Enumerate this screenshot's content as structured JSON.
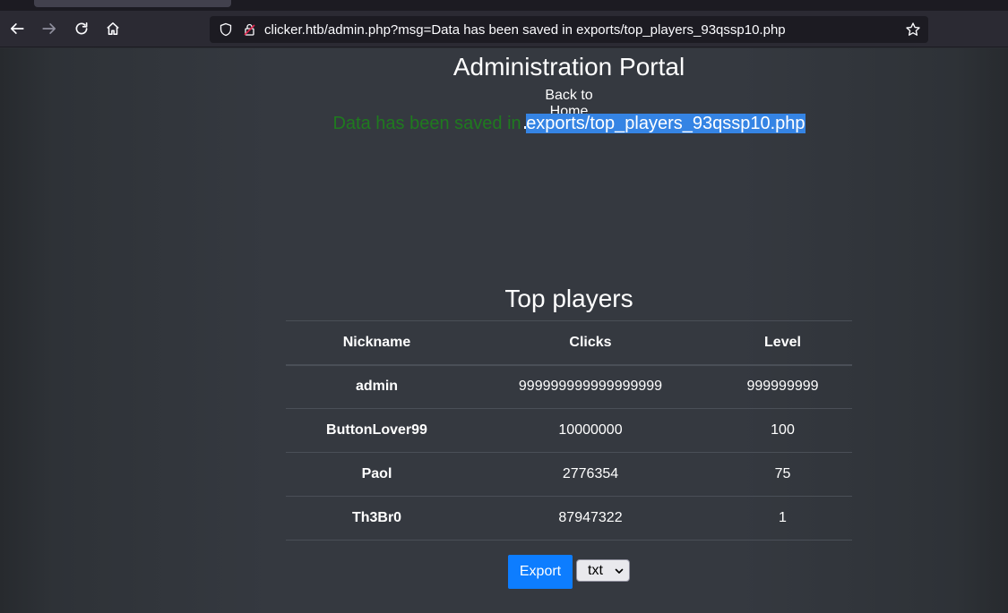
{
  "browser": {
    "url": "clicker.htb/admin.php?msg=Data has been saved in exports/top_players_93qssp10.php"
  },
  "page": {
    "title": "Administration Portal",
    "back_link": "Back to Home",
    "message_prefix": "Data has been saved in ",
    "message_path": "exports/top_players_93qssp10.php",
    "section_title": "Top players",
    "table": {
      "headers": [
        "Nickname",
        "Clicks",
        "Level"
      ],
      "rows": [
        {
          "nickname": "admin",
          "clicks": "999999999999999999",
          "level": "999999999"
        },
        {
          "nickname": "ButtonLover99",
          "clicks": "10000000",
          "level": "100"
        },
        {
          "nickname": "Paol",
          "clicks": "2776354",
          "level": "75"
        },
        {
          "nickname": "Th3Br0",
          "clicks": "87947322",
          "level": "1"
        }
      ]
    },
    "export_button": "Export",
    "export_format": "txt"
  },
  "colors": {
    "success": "#1f7a1f",
    "selection": "#3584e4",
    "primary": "#0d7dff"
  }
}
